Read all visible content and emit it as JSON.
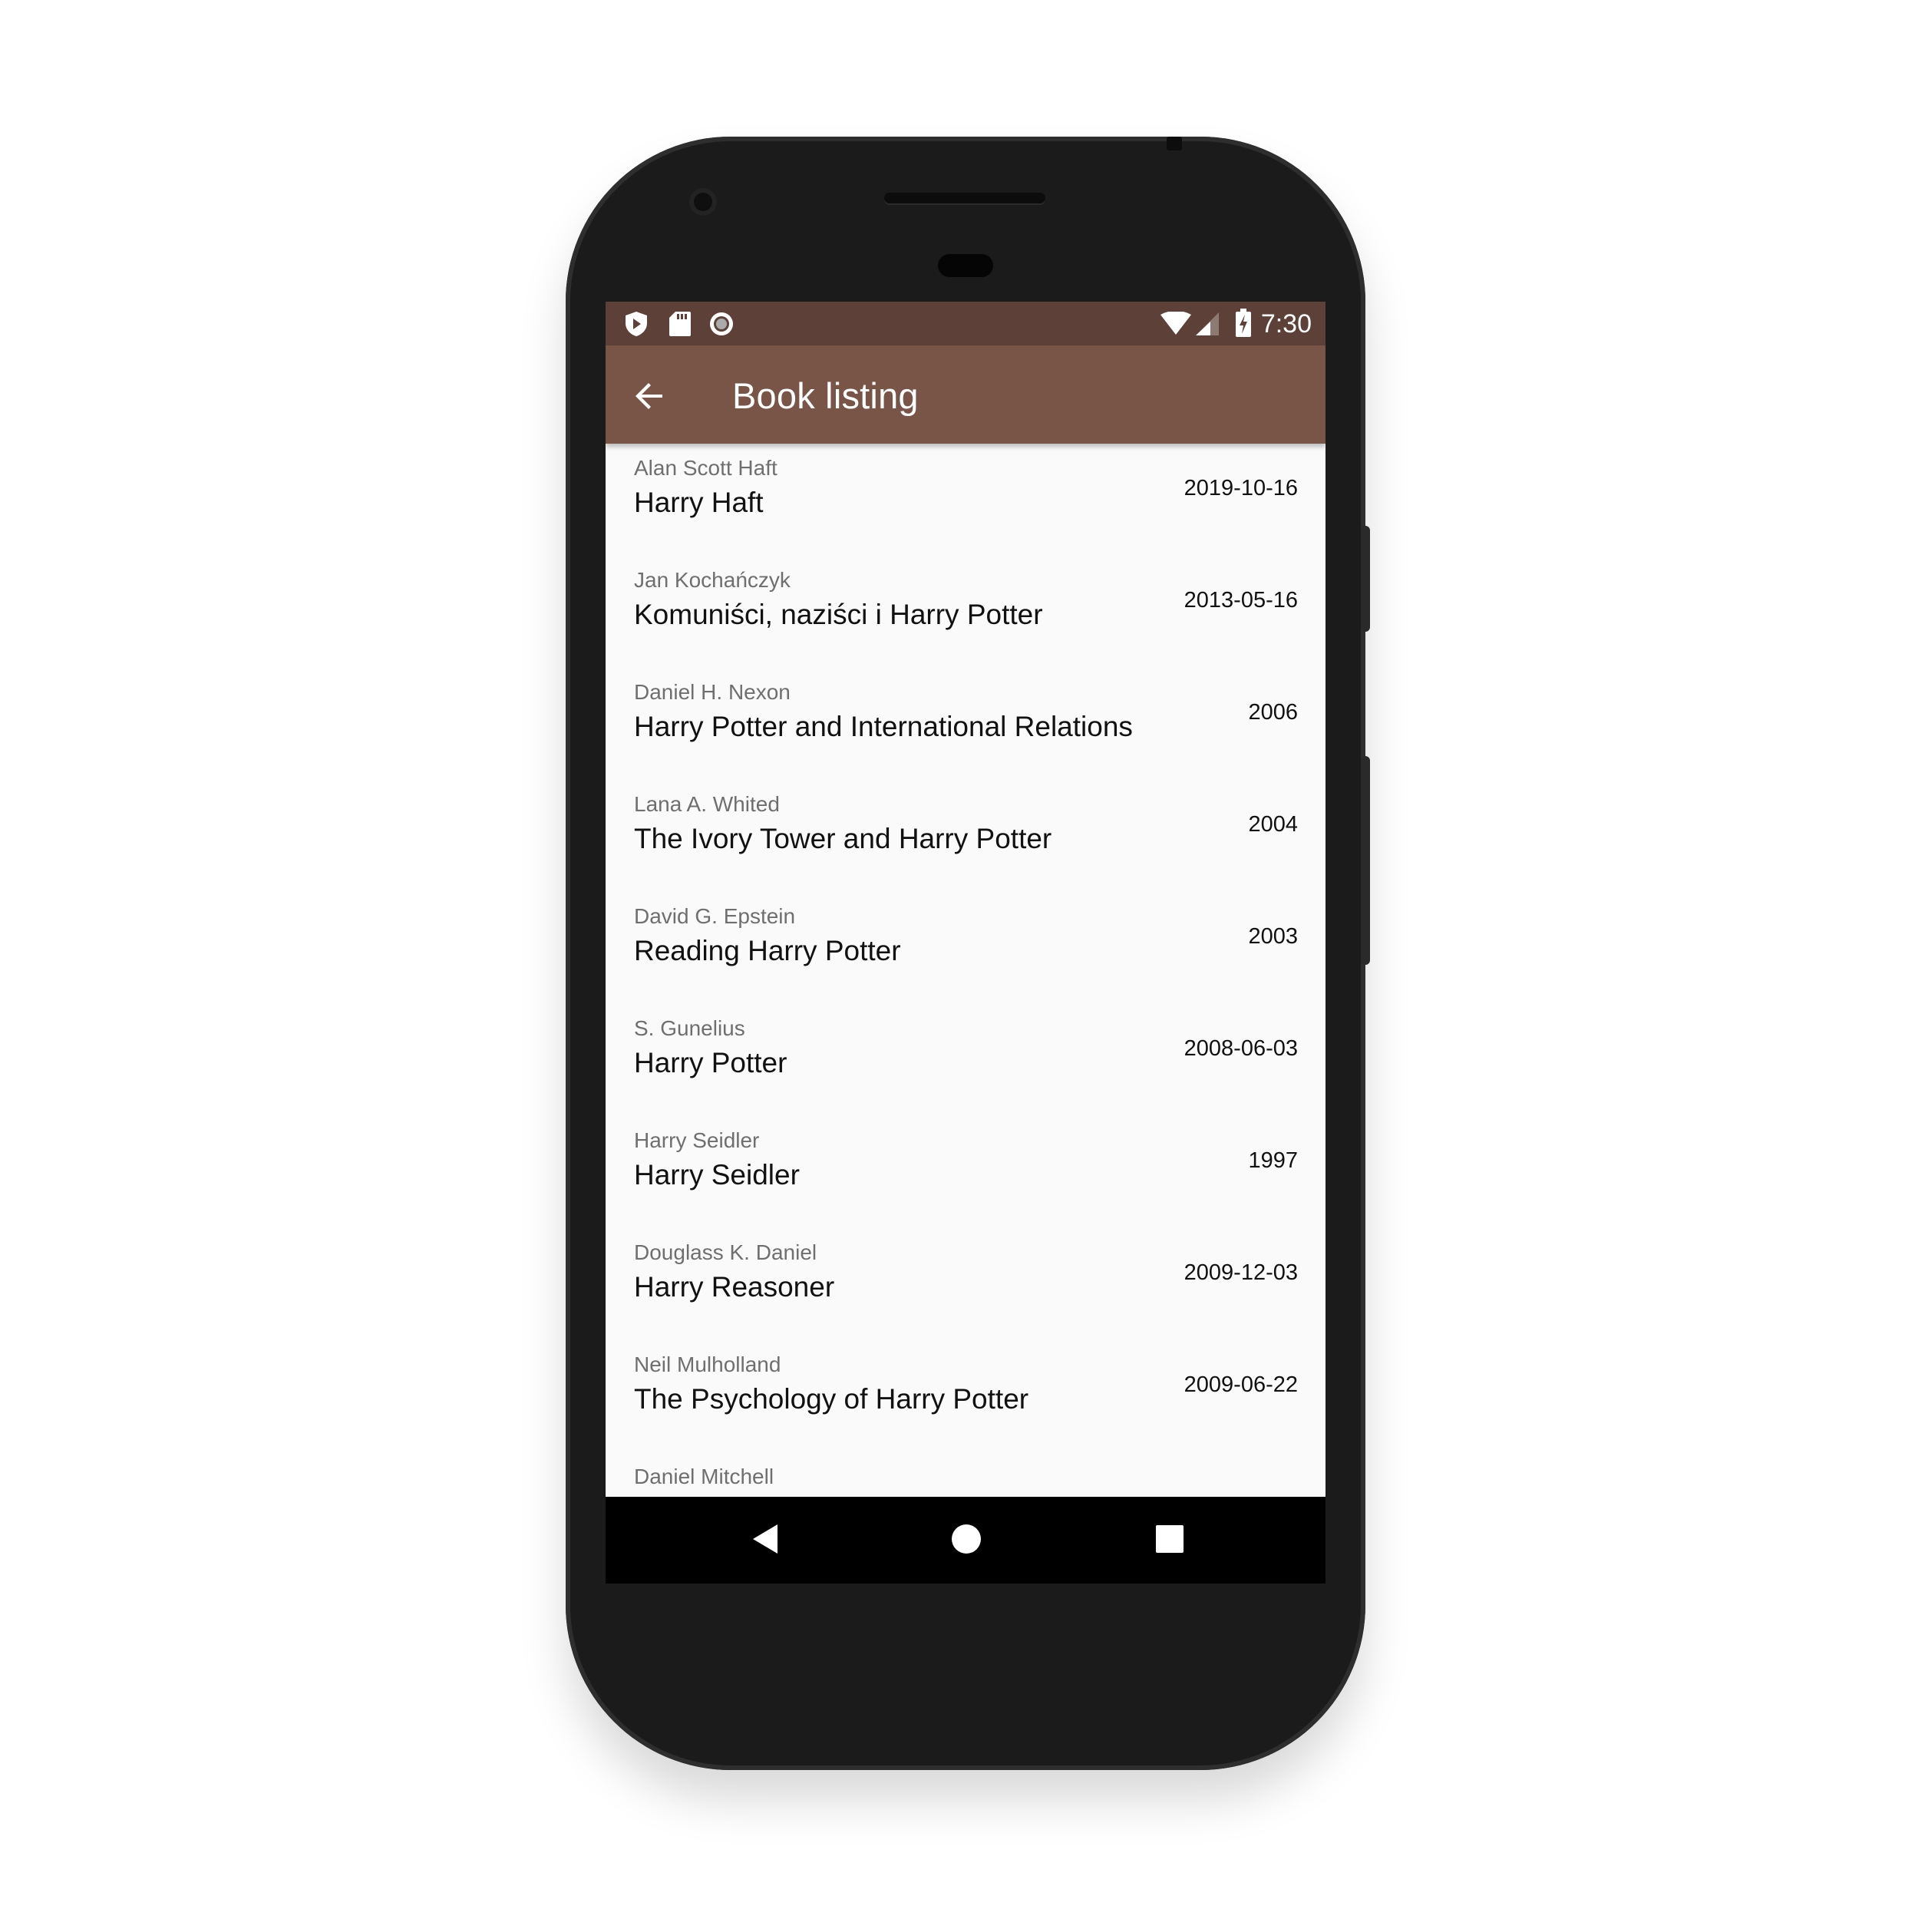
{
  "status_bar": {
    "time": "7:30",
    "left_icons": [
      "shield-play-icon",
      "sd-card-icon",
      "record-icon"
    ],
    "right_icons": [
      "wifi-icon",
      "cell-signal-icon",
      "battery-charging-icon"
    ]
  },
  "app_bar": {
    "title": "Book listing",
    "back_icon": "arrow-back-icon",
    "color": "#795548",
    "status_color": "#5d4037"
  },
  "books": [
    {
      "author": "Alan Scott Haft",
      "title": "Harry Haft",
      "date": "2019-10-16"
    },
    {
      "author": "Jan Kochańczyk",
      "title": "Komuniści, naziści i Harry Potter",
      "date": "2013-05-16"
    },
    {
      "author": "Daniel H. Nexon",
      "title": "Harry Potter and International Relations",
      "date": "2006"
    },
    {
      "author": "Lana A. Whited",
      "title": "The Ivory Tower and Harry Potter",
      "date": "2004"
    },
    {
      "author": "David G. Epstein",
      "title": "Reading Harry Potter",
      "date": "2003"
    },
    {
      "author": "S. Gunelius",
      "title": "Harry Potter",
      "date": "2008-06-03"
    },
    {
      "author": "Harry Seidler",
      "title": "Harry Seidler",
      "date": "1997"
    },
    {
      "author": "Douglass K. Daniel",
      "title": "Harry Reasoner",
      "date": "2009-12-03"
    },
    {
      "author": "Neil Mulholland",
      "title": "The Psychology of Harry Potter",
      "date": "2009-06-22"
    },
    {
      "author": "Daniel Mitchell",
      "title": "",
      "date": ""
    }
  ],
  "nav_bar": {
    "icons": [
      "back-triangle-icon",
      "home-circle-icon",
      "recents-square-icon"
    ]
  }
}
